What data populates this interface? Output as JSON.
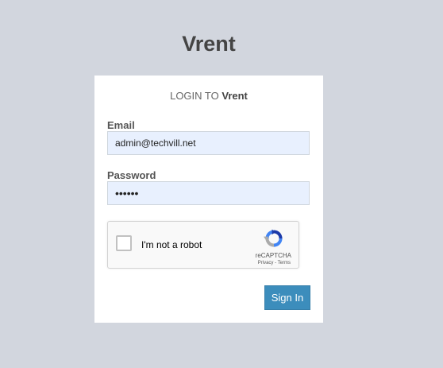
{
  "app": {
    "title": "Vrent"
  },
  "login": {
    "heading_prefix": "LOGIN TO",
    "heading_brand": "Vrent",
    "email_label": "Email",
    "email_value": "admin@techvill.net",
    "password_label": "Password",
    "password_value": "••••••",
    "recaptcha": {
      "label": "I'm not a robot",
      "brand": "reCAPTCHA",
      "privacy": "Privacy",
      "separator": " - ",
      "terms": "Terms"
    },
    "signin_label": "Sign In"
  },
  "colors": {
    "background": "#d2d6de",
    "button": "#3c8dbc",
    "input_fill": "#e8f0fe"
  },
  "icons": {
    "recaptcha_logo": "recaptcha-logo-icon"
  }
}
